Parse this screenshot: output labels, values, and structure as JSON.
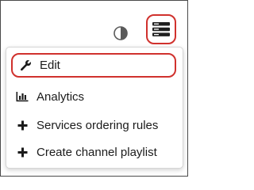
{
  "toolbar": {
    "contrast_icon": "contrast-icon",
    "menu_icon": "hamburger-menu-icon",
    "highlight_color": "#d0312d"
  },
  "menu": {
    "items": [
      {
        "label": "Edit",
        "icon": "wrench-icon"
      },
      {
        "label": "Analytics",
        "icon": "bar-chart-icon"
      },
      {
        "label": "Services ordering rules",
        "icon": "plus-icon"
      },
      {
        "label": "Create channel playlist",
        "icon": "plus-icon"
      }
    ]
  }
}
